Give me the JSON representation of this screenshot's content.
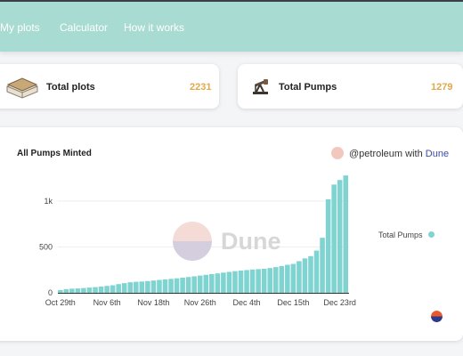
{
  "nav": {
    "items": [
      "My plots",
      "Calculator",
      "How it works"
    ]
  },
  "stats": {
    "plots": {
      "label": "Total plots",
      "value": "2231",
      "icon": "soil-plot-icon"
    },
    "pumps": {
      "label": "Total Pumps",
      "value": "1279",
      "icon": "oil-pump-icon"
    }
  },
  "chart": {
    "title": "All Pumps Minted",
    "credit_prefix": "@petroleum with",
    "credit_link": "Dune",
    "watermark": "Dune"
  },
  "colors": {
    "header": "#a8dbd1",
    "accent_value": "#e2a84b",
    "bar": "#7fd3d0"
  },
  "chart_data": {
    "type": "bar",
    "title": "All Pumps Minted",
    "xlabel": "",
    "ylabel": "",
    "ylim": [
      0,
      1300
    ],
    "yticks": [
      0,
      500,
      1000
    ],
    "ytick_labels": [
      "0",
      "500",
      "1k"
    ],
    "xtick_labels": [
      "Oct 29th",
      "Nov 6th",
      "Nov 18th",
      "Nov 26th",
      "Dec 4th",
      "Dec 15th",
      "Dec 23rd"
    ],
    "xtick_indices": [
      0,
      8,
      16,
      24,
      32,
      40,
      48
    ],
    "legend": {
      "label": "Total Pumps",
      "position": "right"
    },
    "grid": true,
    "series": [
      {
        "name": "Total Pumps",
        "values": [
          30,
          40,
          45,
          48,
          52,
          57,
          62,
          68,
          75,
          82,
          95,
          105,
          115,
          120,
          123,
          128,
          134,
          140,
          146,
          152,
          158,
          165,
          172,
          180,
          188,
          196,
          204,
          212,
          220,
          228,
          236,
          242,
          248,
          254,
          258,
          262,
          270,
          280,
          292,
          305,
          315,
          345,
          375,
          400,
          460,
          600,
          1020,
          1180,
          1230,
          1279
        ]
      }
    ]
  }
}
